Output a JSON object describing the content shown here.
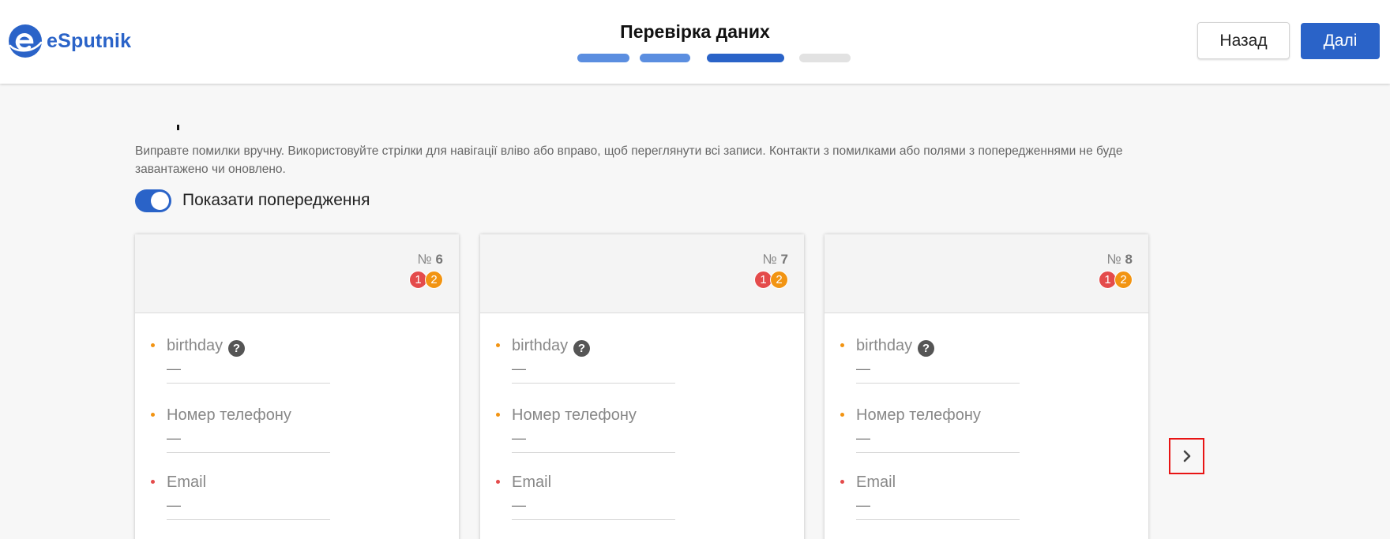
{
  "brand": {
    "name": "eSputnik",
    "color": "#2a63c8"
  },
  "header": {
    "step_title": "Перевірка даних",
    "progress_steps": [
      {
        "state": "done",
        "color": "#5b8ee0"
      },
      {
        "state": "done",
        "color": "#5b8ee0"
      },
      {
        "state": "current",
        "color": "#2a63c8"
      },
      {
        "state": "pending",
        "color": "#e2e2e2"
      }
    ],
    "back_label": "Назад",
    "next_label": "Далі"
  },
  "main": {
    "instructions": "Виправте помилки вручну. Використовуйте стрілки для навігації вліво або вправо, щоб переглянути всі записи. Контакти з помилками або полями з попередженнями не буде завантажено чи оновлено.",
    "toggle": {
      "label": "Показати попередження",
      "on": true
    },
    "cards": [
      {
        "number_prefix": "№",
        "number": "6",
        "errors": "1",
        "warnings": "2",
        "fields": [
          {
            "label": "birthday",
            "value": "—",
            "severity": "warning",
            "help": true
          },
          {
            "label": "Номер телефону",
            "value": "—",
            "severity": "warning",
            "help": false
          },
          {
            "label": "Email",
            "value": "—",
            "severity": "error",
            "help": false
          }
        ]
      },
      {
        "number_prefix": "№",
        "number": "7",
        "errors": "1",
        "warnings": "2",
        "fields": [
          {
            "label": "birthday",
            "value": "—",
            "severity": "warning",
            "help": true
          },
          {
            "label": "Номер телефону",
            "value": "—",
            "severity": "warning",
            "help": false
          },
          {
            "label": "Email",
            "value": "—",
            "severity": "error",
            "help": false
          }
        ]
      },
      {
        "number_prefix": "№",
        "number": "8",
        "errors": "1",
        "warnings": "2",
        "fields": [
          {
            "label": "birthday",
            "value": "—",
            "severity": "warning",
            "help": true
          },
          {
            "label": "Номер телефону",
            "value": "—",
            "severity": "warning",
            "help": false
          },
          {
            "label": "Email",
            "value": "—",
            "severity": "error",
            "help": false
          }
        ]
      }
    ],
    "help_icon_glyph": "?",
    "next_arrow_icon": "chevron-right-icon"
  },
  "colors": {
    "warning": "#f29412",
    "error": "#e44b4b",
    "highlight": "#e81414"
  }
}
